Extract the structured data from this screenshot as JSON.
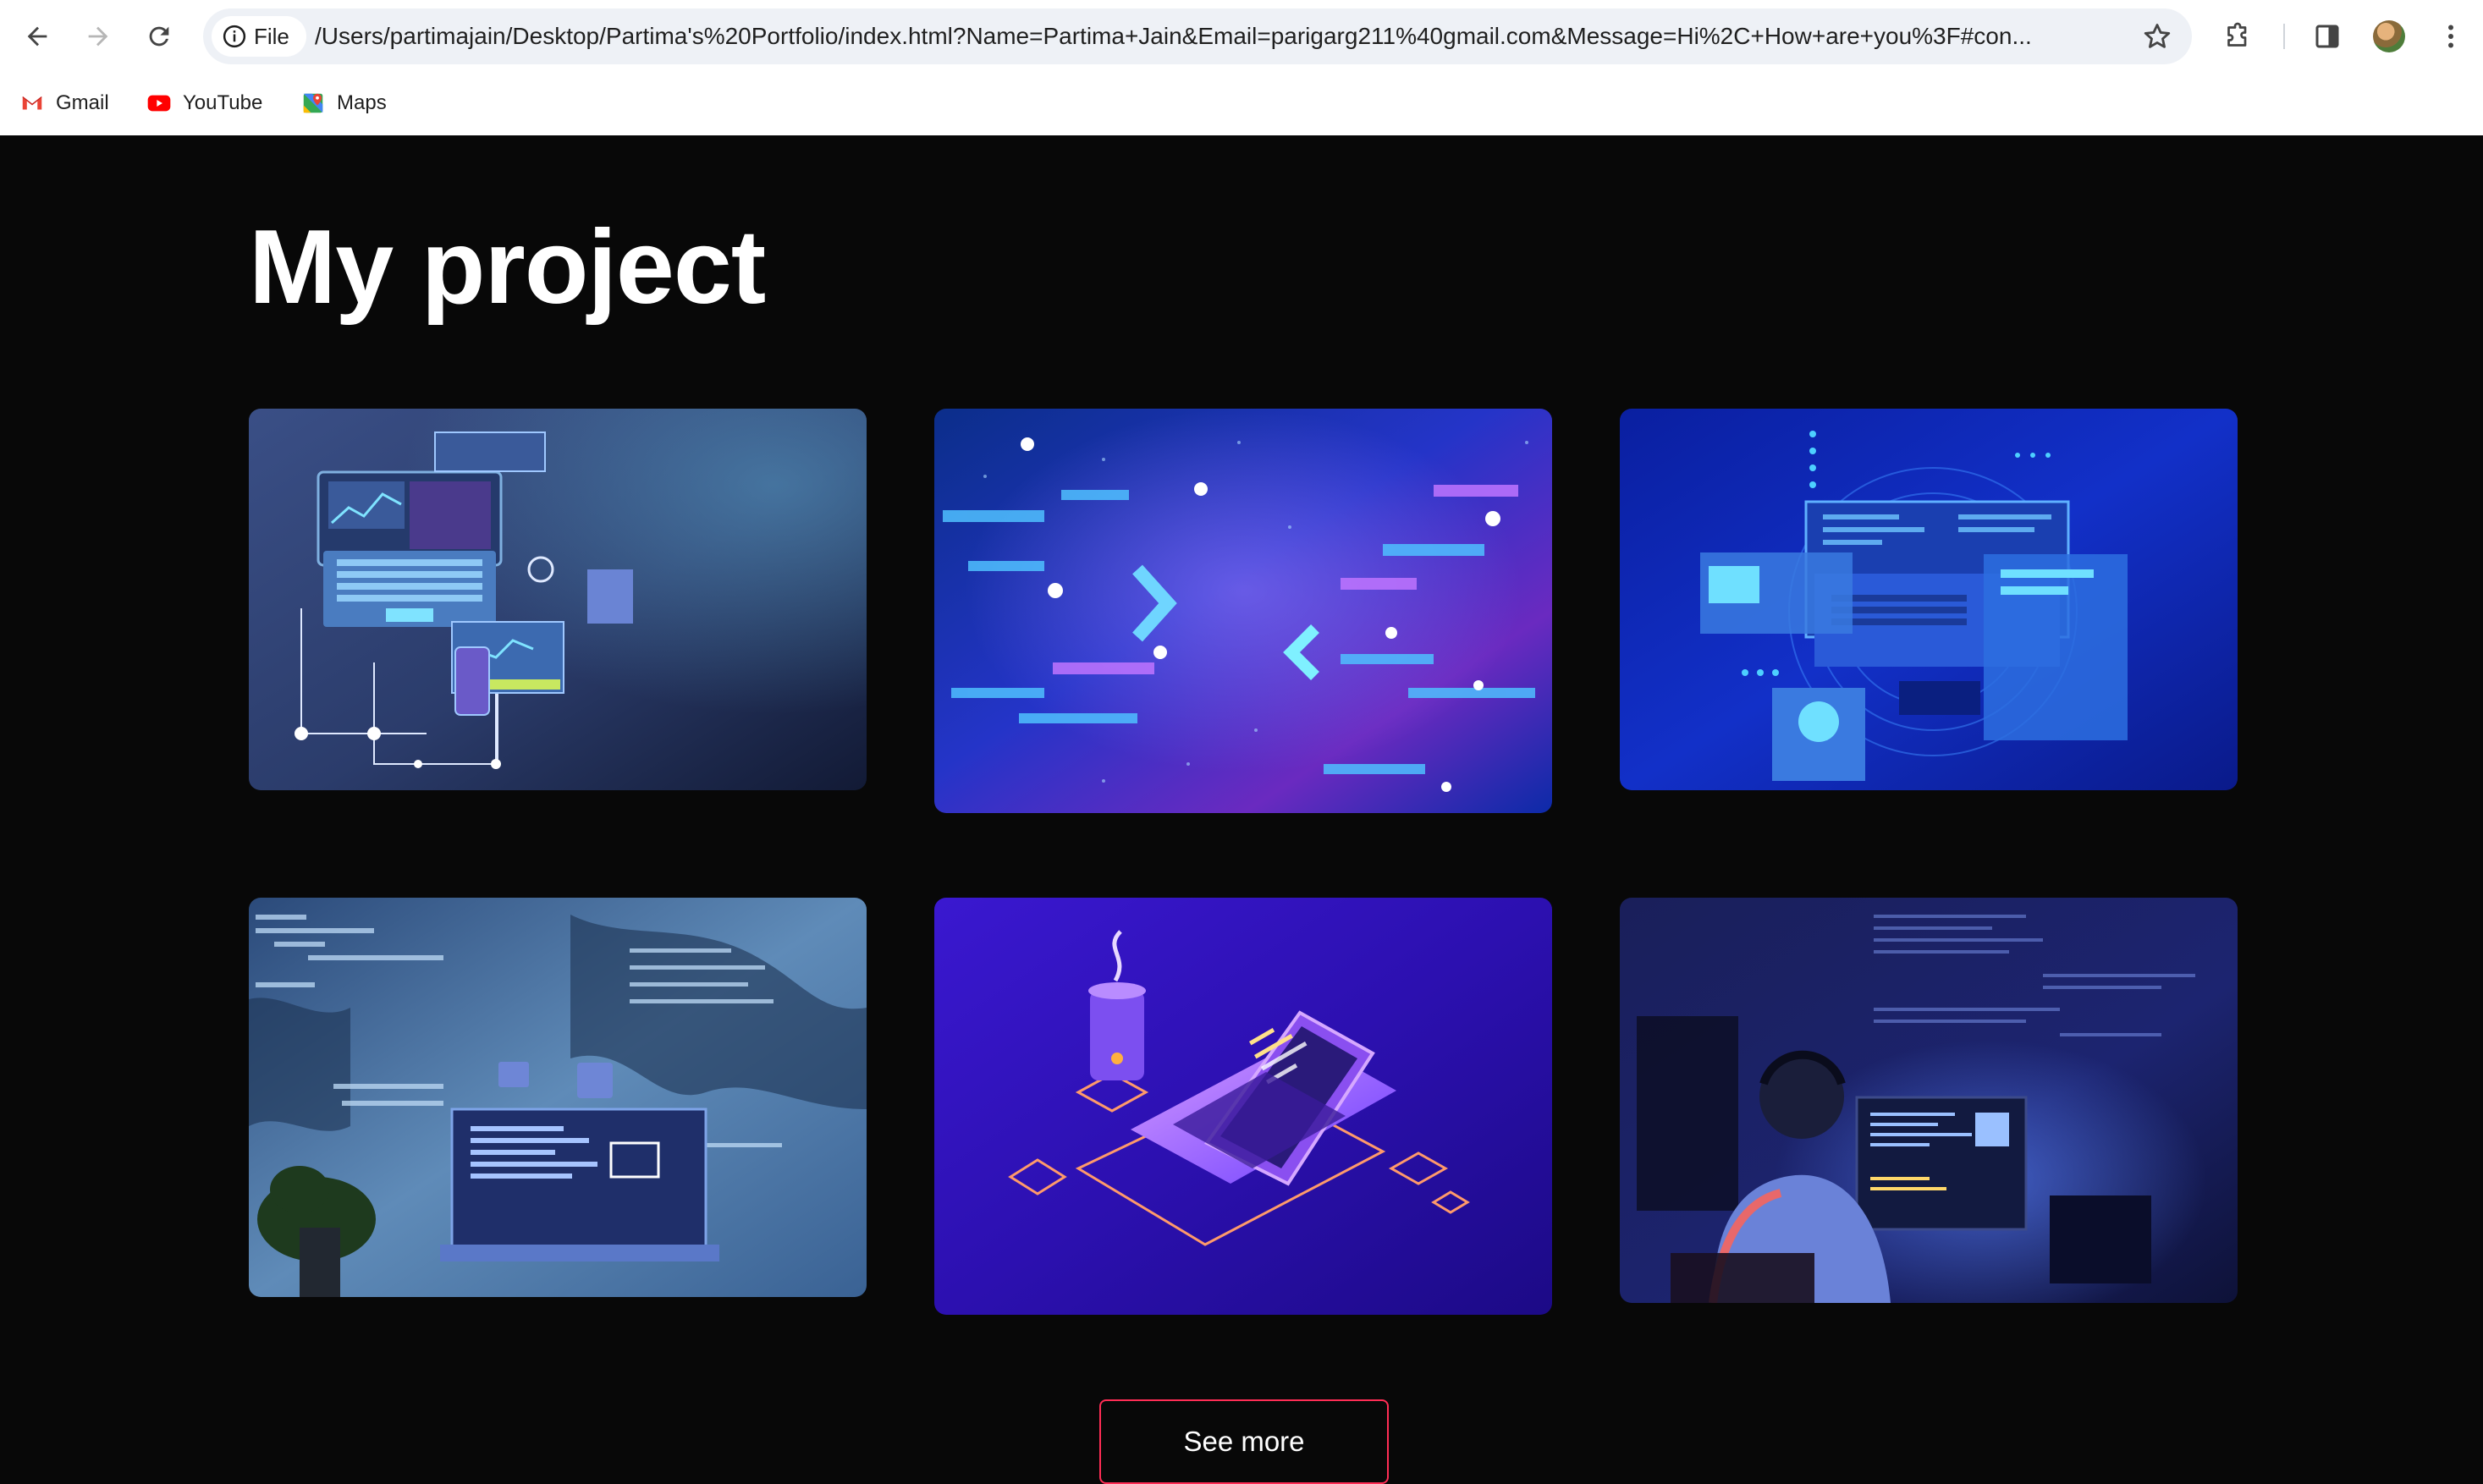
{
  "browser": {
    "site_chip_label": "File",
    "url": "/Users/partimajain/Desktop/Partima's%20Portfolio/index.html?Name=Partima+Jain&Email=parigarg211%40gmail.com&Message=Hi%2C+How+are+you%3F#con...",
    "bookmarks": [
      {
        "label": "Gmail",
        "icon": "gmail-icon"
      },
      {
        "label": "YouTube",
        "icon": "youtube-icon"
      },
      {
        "label": "Maps",
        "icon": "maps-icon"
      }
    ]
  },
  "projects": {
    "heading": "My project",
    "cards": [
      {
        "image": "laptop-devices-illustration"
      },
      {
        "image": "digital-circuit-arrows-illustration"
      },
      {
        "image": "laptop-ui-panels-illustration"
      },
      {
        "image": "code-editor-laptop-photo"
      },
      {
        "image": "isometric-laptop-coffee-illustration"
      },
      {
        "image": "developer-at-monitors-photo"
      }
    ],
    "see_more_label": "See more"
  },
  "colors": {
    "page_background": "#080808",
    "button_border": "#ff2d55",
    "text": "#ffffff"
  }
}
